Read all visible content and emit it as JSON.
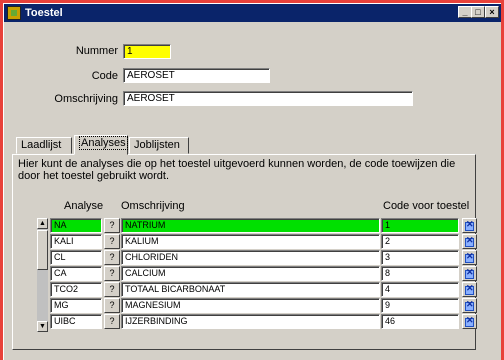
{
  "window": {
    "title": "Toestel",
    "min_label": "_",
    "max_label": "□",
    "close_label": "×"
  },
  "form": {
    "nummer_label": "Nummer",
    "nummer_value": "1",
    "code_label": "Code",
    "code_value": "AEROSET",
    "omschrijving_label": "Omschrijving",
    "omschrijving_value": "AEROSET"
  },
  "tabs": [
    {
      "label": "Laadlijst"
    },
    {
      "label": "Analyses"
    },
    {
      "label": "Joblijsten"
    }
  ],
  "panel": {
    "description": "Hier kunt de analyses die op het toestel uitgevoerd kunnen worden, de code toewijzen die door het toestel gebruikt wordt.",
    "col_analyse": "Analyse",
    "col_omschrijving": "Omschrijving",
    "col_code": "Code voor toestel",
    "rows": [
      {
        "analyse": "NA",
        "lookup": "?",
        "omschrijving": "NATRIUM",
        "code": "1"
      },
      {
        "analyse": "KALI",
        "lookup": "?",
        "omschrijving": "KALIUM",
        "code": "2"
      },
      {
        "analyse": "CL",
        "lookup": "?",
        "omschrijving": "CHLORIDEN",
        "code": "3"
      },
      {
        "analyse": "CA",
        "lookup": "?",
        "omschrijving": "CALCIUM",
        "code": "8"
      },
      {
        "analyse": "TCO2",
        "lookup": "?",
        "omschrijving": "TOTAAL BICARBONAAT",
        "code": "4"
      },
      {
        "analyse": "MG",
        "lookup": "?",
        "omschrijving": "MAGNESIUM",
        "code": "9"
      },
      {
        "analyse": "UIBC",
        "lookup": "?",
        "omschrijving": "IJZERBINDING",
        "code": "46"
      }
    ]
  },
  "scroll": {
    "up": "▲",
    "down": "▼"
  },
  "colors": {
    "highlight": "#00e000",
    "nummer_bg": "#ffff00",
    "titlebar": "#0a246a"
  }
}
